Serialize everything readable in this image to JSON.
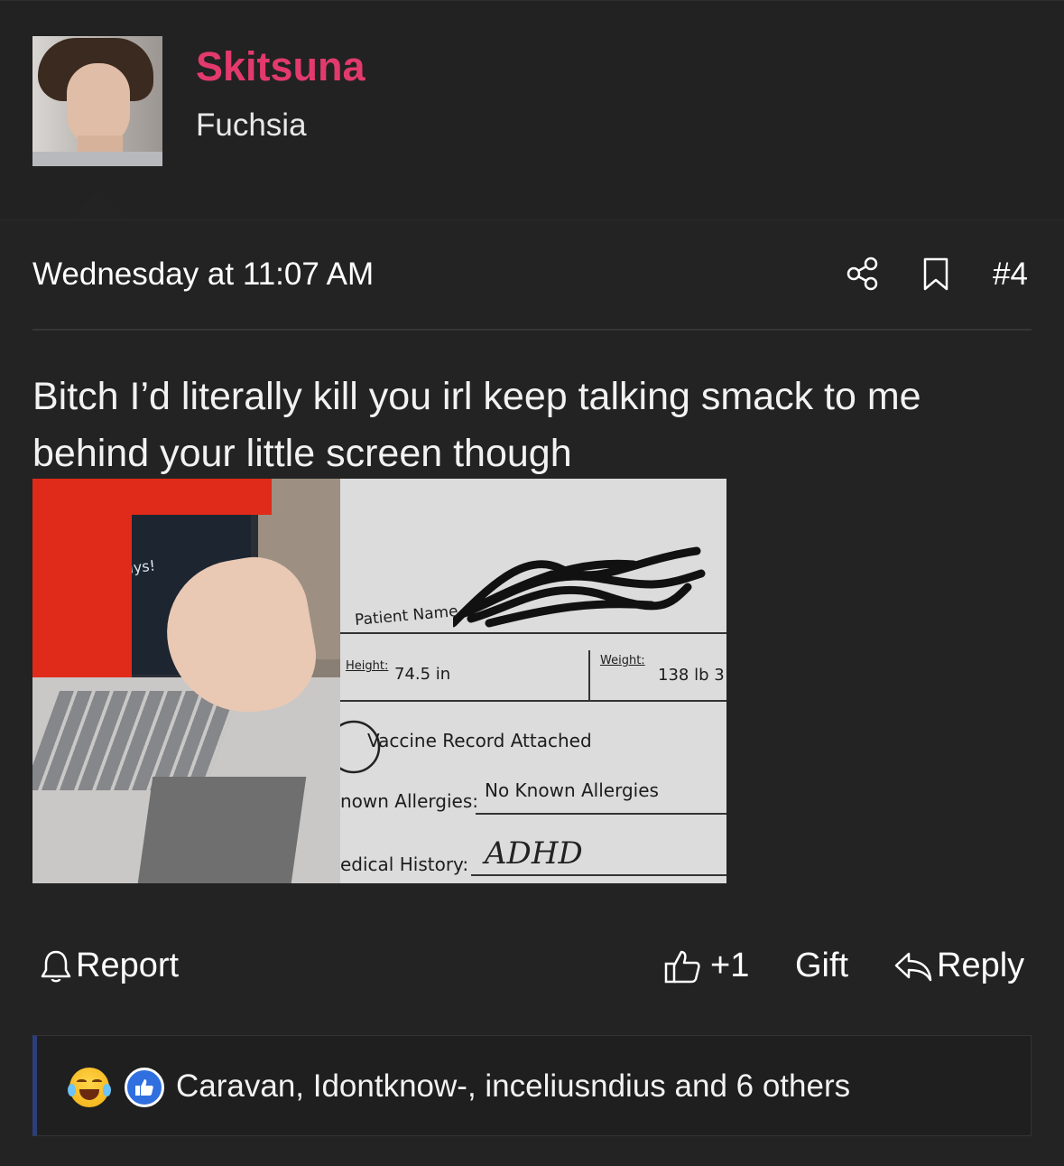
{
  "author": {
    "username": "Skitsuna",
    "user_title": "Fuchsia",
    "username_color": "#e23a6d"
  },
  "post": {
    "timestamp": "Wednesday at 11:07 AM",
    "number": "#4",
    "body": "Bitch I’d literally kill you irl keep talking smack to me behind your little screen though",
    "icons": [
      "share-icon",
      "bookmark-icon"
    ]
  },
  "attachment": {
    "screen_text": "Hi guys!",
    "form": {
      "patient_name_label": "Patient Name",
      "height_label": "Height:",
      "height_value": "74.5 in",
      "weight_label": "Weight:",
      "weight_value": "138 lb 3",
      "vaccine_label": "Vaccine Record Attached",
      "allergies_label": "nown Allergies:",
      "allergies_value": "No Known Allergies",
      "history_label": "edical History:",
      "history_value": "ADHD"
    }
  },
  "actions": {
    "report": "Report",
    "like": "+1",
    "gift": "Gift",
    "reply": "Reply"
  },
  "reactions": {
    "icons": [
      "laughing-crying-emoji-icon",
      "thumbs-up-like-icon"
    ],
    "text": "Caravan, Idontknow-, inceliusndius and 6 others",
    "accent": "#2c3f7a"
  }
}
